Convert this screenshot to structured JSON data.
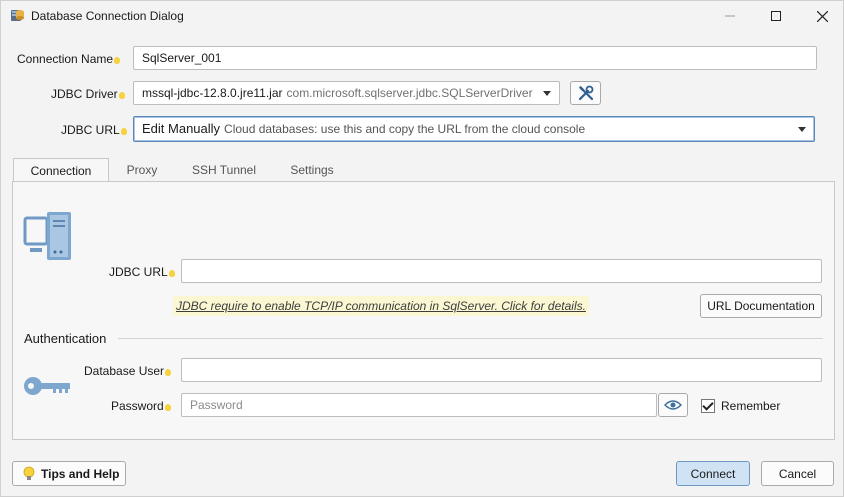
{
  "window": {
    "title": "Database Connection Dialog",
    "minimize_glyph": "—",
    "maximize_glyph": "☐",
    "close_glyph": "✕"
  },
  "form": {
    "connection_name_label": "Connection Name",
    "connection_name_value": "SqlServer_001",
    "jdbc_driver_label": "JDBC Driver",
    "jdbc_driver_jar": "mssql-jdbc-12.8.0.jre11.jar",
    "jdbc_driver_class": "com.microsoft.sqlserver.jdbc.SQLServerDriver",
    "jdbc_url_label": "JDBC URL",
    "jdbc_url_mode": "Edit Manually",
    "jdbc_url_mode_hint": "Cloud databases: use this and copy the URL from the cloud console"
  },
  "tabs": [
    {
      "label": "Connection",
      "active": true
    },
    {
      "label": "Proxy",
      "active": false
    },
    {
      "label": "SSH Tunnel",
      "active": false
    },
    {
      "label": "Settings",
      "active": false
    }
  ],
  "connection_tab": {
    "jdbc_url_label": "JDBC URL",
    "jdbc_url_value": "",
    "tcp_hint": "JDBC require to enable TCP/IP communication in SqlServer. Click for details.",
    "url_doc_button": "URL Documentation",
    "auth_title": "Authentication",
    "db_user_label": "Database User",
    "db_user_value": "",
    "password_label": "Password",
    "password_placeholder": "Password",
    "remember_label": "Remember",
    "remember_checked": true
  },
  "footer": {
    "tips_button": "Tips and Help",
    "connect_button": "Connect",
    "cancel_button": "Cancel"
  },
  "icons": {
    "app": "database-icon",
    "driver_settings": "tools-icon",
    "server": "server-icon",
    "key": "key-icon",
    "eye": "eye-icon",
    "bulb": "lightbulb-icon"
  },
  "colors": {
    "primary_button": "#cfe3f5",
    "hint_background": "#fbf7d2",
    "bulb": "#f7d23e"
  }
}
